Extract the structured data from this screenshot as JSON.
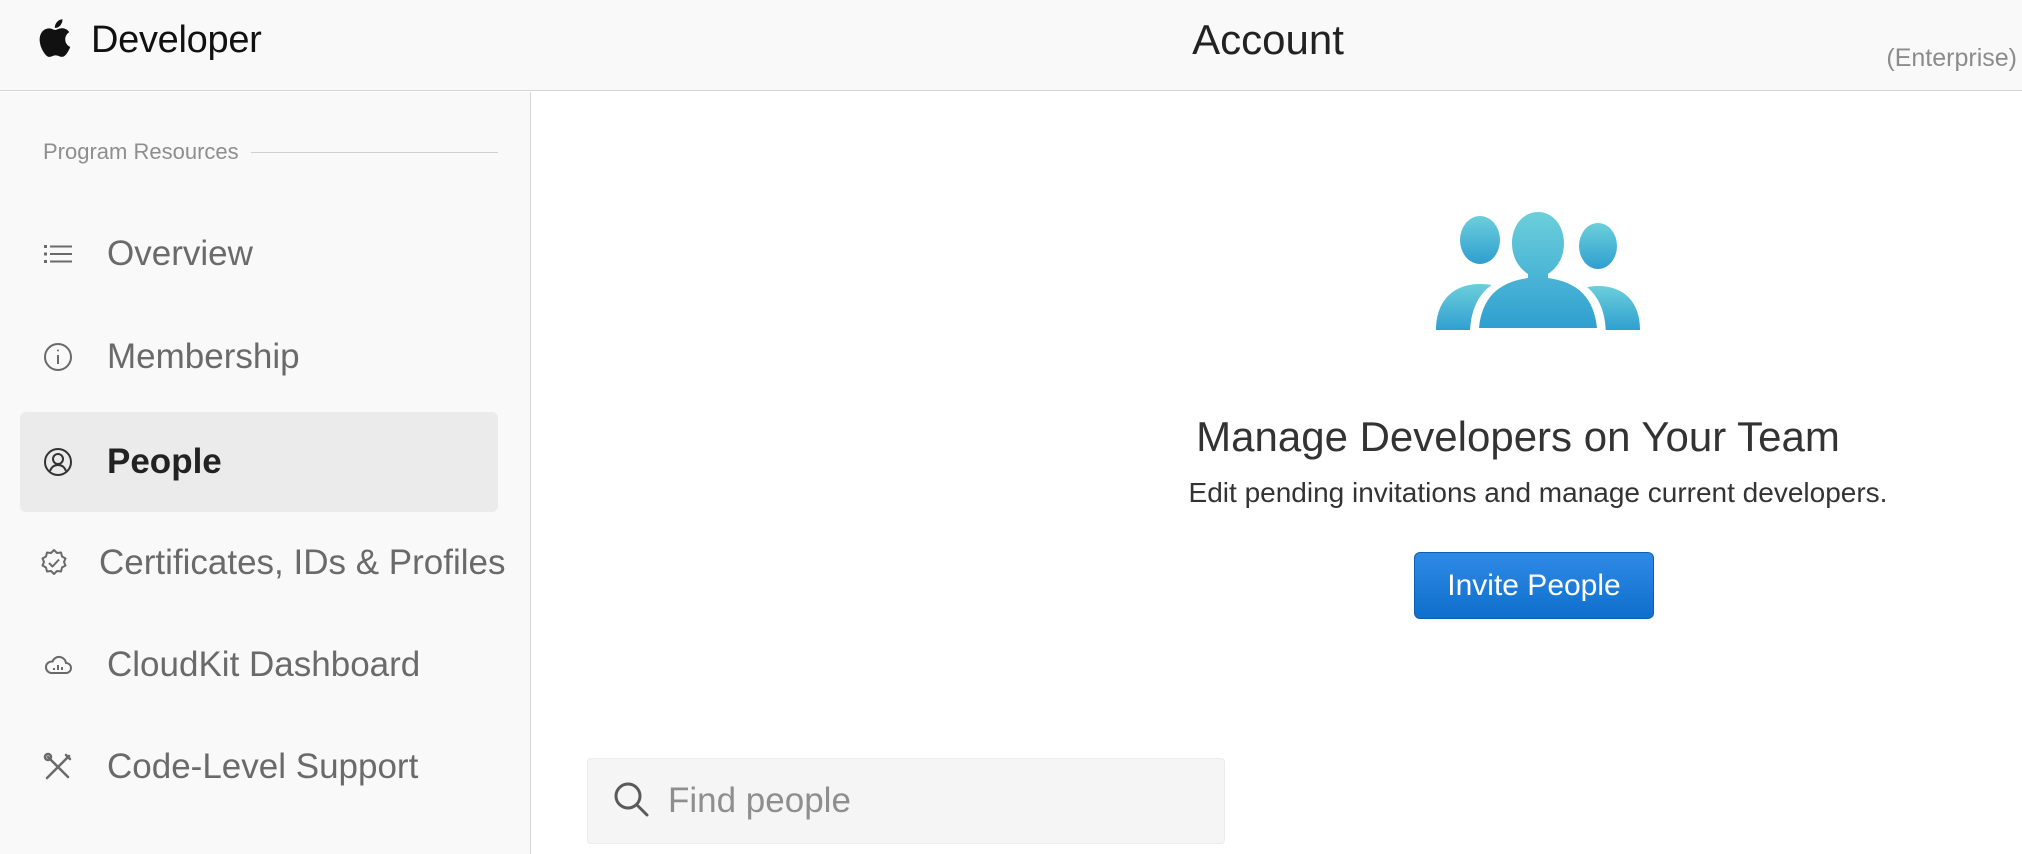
{
  "header": {
    "brand_label": "Developer",
    "title": "Account",
    "badge": "(Enterprise)",
    "logo_icon": "apple-logo-icon"
  },
  "sidebar": {
    "section_label": "Program Resources",
    "items": [
      {
        "label": "Overview",
        "icon": "list-icon",
        "active": false
      },
      {
        "label": "Membership",
        "icon": "info-icon",
        "active": false
      },
      {
        "label": "People",
        "icon": "person-icon",
        "active": true
      },
      {
        "label": "Certificates, IDs & Profiles",
        "icon": "badge-check-icon",
        "active": false
      },
      {
        "label": "CloudKit Dashboard",
        "icon": "cloud-dashboard-icon",
        "active": false
      },
      {
        "label": "Code-Level Support",
        "icon": "tools-icon",
        "active": false
      }
    ]
  },
  "main": {
    "hero_icon": "team-people-icon",
    "title": "Manage Developers on Your Team",
    "subtitle": "Edit pending invitations and manage current developers.",
    "invite_label": "Invite People",
    "search": {
      "placeholder": "Find people",
      "value": ""
    }
  },
  "colors": {
    "accent": "#1a7ad9",
    "hero_icon_top": "#6ccfdb",
    "hero_icon_bottom": "#2f9fd0",
    "sidebar_bg": "#f9f9f9",
    "active_item_bg": "#ebebeb"
  }
}
